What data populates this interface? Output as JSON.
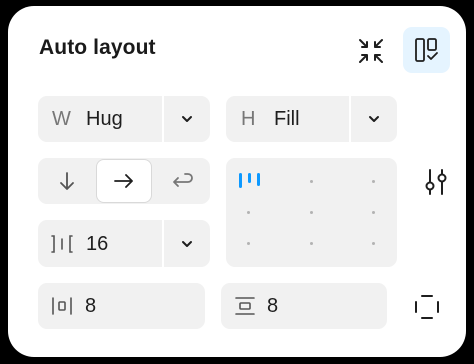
{
  "panel": {
    "title": "Auto layout"
  },
  "size": {
    "width_letter": "W",
    "width_value": "Hug",
    "height_letter": "H",
    "height_value": "Fill"
  },
  "direction": {
    "options": [
      "down",
      "right",
      "wrap"
    ],
    "selected": "right"
  },
  "gap": {
    "value": "16"
  },
  "padding": {
    "horizontal": "8",
    "vertical": "8"
  },
  "colors": {
    "accent": "#0d99ff",
    "active_bg": "#e5f4ff",
    "field_bg": "#f1f1f1"
  }
}
